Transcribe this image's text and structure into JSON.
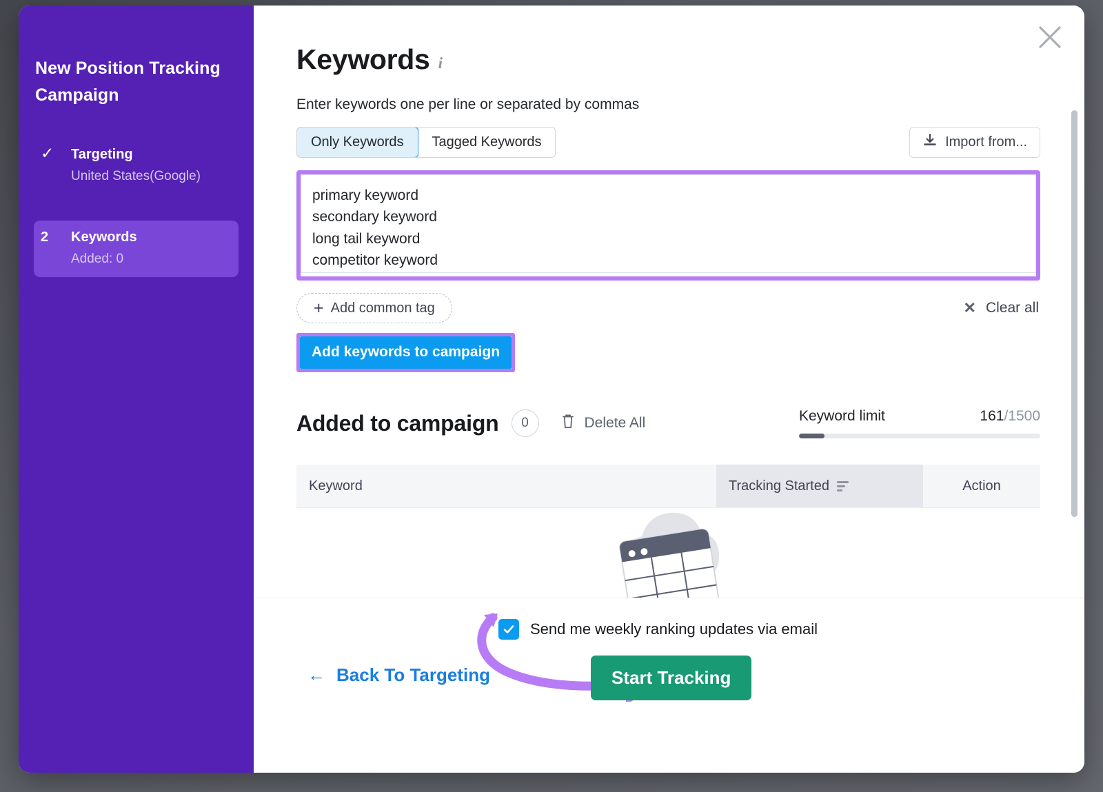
{
  "sidebar": {
    "title": "New Position Tracking Campaign",
    "steps": [
      {
        "marker": "✓",
        "label": "Targeting",
        "sub": "United States(Google)",
        "active": false
      },
      {
        "marker": "2",
        "label": "Keywords",
        "sub": "Added: 0",
        "active": true
      }
    ]
  },
  "main": {
    "close_icon": "close-icon",
    "page_title": "Keywords",
    "info_icon": "i",
    "hint": "Enter keywords one per line or separated by commas",
    "segmented": {
      "options": [
        "Only Keywords",
        "Tagged Keywords"
      ],
      "selected": "Only Keywords"
    },
    "import_button": "Import from...",
    "textarea": {
      "value": "primary keyword\nsecondary keyword\nlong tail keyword\ncompetitor keyword",
      "placeholder": "Enter keywords"
    },
    "add_common_tag": "Add common tag",
    "clear_all": "Clear all",
    "add_keywords_button": "Add keywords to campaign",
    "added_section": {
      "title": "Added to campaign",
      "count": "0",
      "delete_all": "Delete All"
    },
    "keyword_limit": {
      "label": "Keyword limit",
      "used": "161",
      "separator": "/",
      "total": "1500",
      "percent": 10.7
    },
    "table": {
      "columns": [
        "Keyword",
        "Tracking Started",
        "Action"
      ],
      "rows": []
    }
  },
  "footer": {
    "checkbox_label": "Send me weekly ranking updates via email",
    "checkbox_checked": true,
    "back_label": "Back To Targeting",
    "back_arrow": "←",
    "start_label": "Start Tracking"
  },
  "colors": {
    "sidebar_purple": "#5521b5",
    "step_active_purple": "#7a46d8",
    "highlight_purple": "#b77cf5",
    "primary_blue": "#0b9bf0",
    "link_blue": "#1a7ee0",
    "green": "#189a74",
    "backdrop": "#5c5f66"
  }
}
